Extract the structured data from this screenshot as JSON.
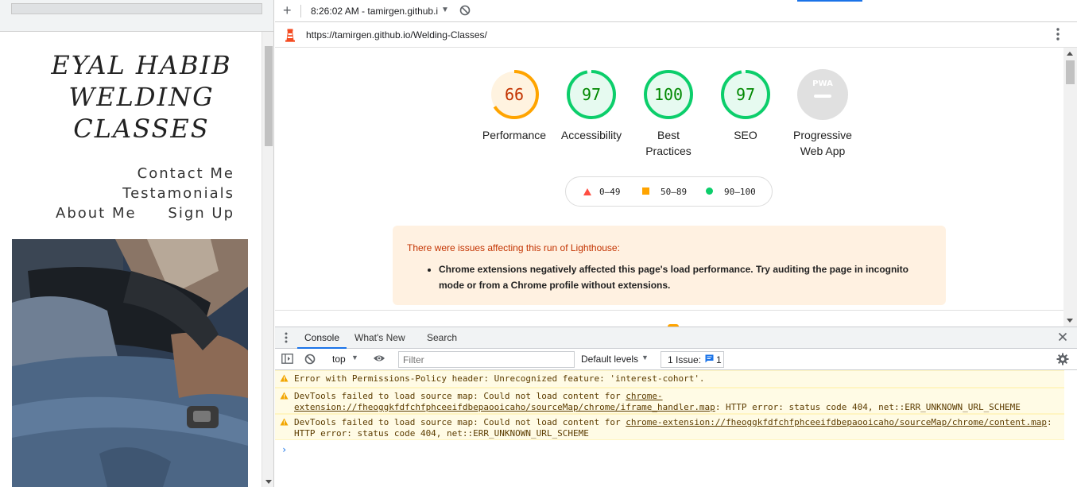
{
  "site": {
    "title_lines": [
      "EYAL HABIB",
      "WELDING",
      "CLASSES"
    ],
    "nav": {
      "contact": "Contact Me",
      "testimonials": "Testamonials",
      "about": "About Me",
      "signup": "Sign Up"
    }
  },
  "devtools": {
    "toolbar": {
      "report_title": "8:26:02 AM - tamirgen.github.i"
    },
    "lighthouse": {
      "url": "https://tamirgen.github.io/Welding-Classes/",
      "gauges": [
        {
          "label": "Performance",
          "score": "66",
          "value": 66,
          "color": "#ffa400",
          "fill": "#fff3e0",
          "text_color": "#c33300"
        },
        {
          "label": "Accessibility",
          "score": "97",
          "value": 97,
          "color": "#0cce6b",
          "fill": "#e6faf0",
          "text_color": "#008800"
        },
        {
          "label": "Best Practices",
          "score": "100",
          "value": 100,
          "color": "#0cce6b",
          "fill": "#e6faf0",
          "text_color": "#008800"
        },
        {
          "label": "SEO",
          "score": "97",
          "value": 97,
          "color": "#0cce6b",
          "fill": "#e6faf0",
          "text_color": "#008800"
        },
        {
          "label": "Progressive Web App",
          "score": "",
          "value": 0,
          "color": "#e0e0e0",
          "fill": "#e0e0e0",
          "text_color": "#9e9e9e",
          "pwa": true,
          "badge": "PWA"
        }
      ],
      "legend": {
        "fail": "0–49",
        "average": "50–89",
        "pass": "90–100",
        "colors": {
          "fail": "#ff4e42",
          "average": "#ffa400",
          "pass": "#0cce6b"
        }
      },
      "warning": {
        "title": "There were issues affecting this run of Lighthouse:",
        "items": [
          "Chrome extensions negatively affected this page's load performance. Try auditing the page in incognito mode or from a Chrome profile without extensions."
        ]
      }
    },
    "drawer": {
      "tabs": {
        "console": "Console",
        "whats_new": "What's New",
        "search": "Search"
      },
      "toolbar": {
        "context": "top",
        "filter_placeholder": "Filter",
        "levels": "Default levels",
        "issues_label": "1 Issue:",
        "issues_count": "1"
      },
      "messages": [
        {
          "text": "Error with Permissions-Policy header: Unrecognized feature: 'interest-cohort'."
        },
        {
          "prefix": "DevTools failed to load source map: Could not load content for ",
          "link": "chrome-extension://fheoggkfdfchfphceeifdbepaooicaho/sourceMap/chrome/iframe_handler.map",
          "suffix": ": HTTP error: status code 404, net::ERR_UNKNOWN_URL_SCHEME"
        },
        {
          "prefix": "DevTools failed to load source map: Could not load content for ",
          "link": "chrome-extension://fheoggkfdfchfphceeifdbepaooicaho/sourceMap/chrome/content.map",
          "suffix": ": HTTP error: status code 404, net::ERR_UNKNOWN_URL_SCHEME"
        }
      ],
      "prompt": "›"
    }
  },
  "icons": {
    "lighthouse": "lighthouse-icon",
    "warning": "warning-triangle-icon",
    "clear": "block-icon",
    "eye": "eye-icon",
    "gear": "gear-icon",
    "close": "close-icon",
    "kebab": "kebab-menu-icon",
    "sidebar": "sidebar-toggle-icon",
    "issue": "message-icon"
  }
}
